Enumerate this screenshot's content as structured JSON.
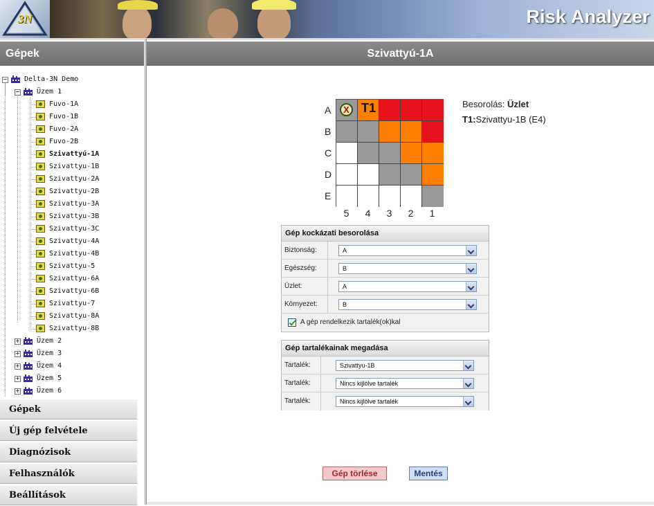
{
  "header": {
    "logo_text": "3N",
    "app_title": "Risk Analyzer"
  },
  "left_panel": {
    "title": "Gépek"
  },
  "tree": {
    "root": "Delta-3N Demo",
    "plant_open": "Üzem 1",
    "machines": [
      "Fuvo-1A",
      "Fuvo-1B",
      "Fuvo-2A",
      "Fuvo-2B",
      "Szivattyú-1A",
      "Szivattyu-1B",
      "Szivattyu-2A",
      "Szivattyu-2B",
      "Szivattyu-3A",
      "Szivattyu-3B",
      "Szivattyu-3C",
      "Szivattyu-4A",
      "Szivattyu-4B",
      "Szivattyu-5",
      "Szivattyu-6A",
      "Szivattyu-6B",
      "Szivattyu-7",
      "Szivattyu-8A",
      "Szivattyu-8B"
    ],
    "selected": "Szivattyú-1A",
    "other_plants": [
      "Üzem 2",
      "Üzem 3",
      "Üzem 4",
      "Üzem 5",
      "Üzem 6"
    ],
    "expand_symbol": "+",
    "collapse_symbol": "−"
  },
  "nav": {
    "items": [
      "Gépek",
      "Új gép felvétele",
      "Diagnózisok",
      "Felhasználók",
      "Beállítások"
    ]
  },
  "main": {
    "title": "Szivattyú-1A"
  },
  "matrix": {
    "rows": [
      "A",
      "B",
      "C",
      "D",
      "E"
    ],
    "cols": [
      "5",
      "4",
      "3",
      "2",
      "1"
    ],
    "colors": {
      "red": "#e8141b",
      "orange": "#ff8000",
      "gray": "#999999",
      "white": "#ffffff"
    },
    "cells": [
      [
        "gray",
        "orange",
        "red",
        "red",
        "red"
      ],
      [
        "gray",
        "gray",
        "orange",
        "orange",
        "red"
      ],
      [
        "white",
        "gray",
        "gray",
        "orange",
        "orange"
      ],
      [
        "white",
        "white",
        "gray",
        "gray",
        "orange"
      ],
      [
        "white",
        "white",
        "white",
        "white",
        "gray"
      ]
    ],
    "machine_marker": "X",
    "backup_marker": "T1"
  },
  "info": {
    "classification_label": "Besorolás:",
    "classification_value": "Üzlet",
    "backup_label": "T1:",
    "backup_value": "Szivattyu-1B (E4)"
  },
  "risk_panel": {
    "title": "Gép kockázati besorolása",
    "fields": [
      {
        "label": "Biztonság:",
        "value": "A"
      },
      {
        "label": "Egészség:",
        "value": "B"
      },
      {
        "label": "Üzlet:",
        "value": "A"
      },
      {
        "label": "Környezet:",
        "value": "B"
      }
    ],
    "checkbox_label": "A gép rendelkezik tartalék(ok)kal"
  },
  "backup_panel": {
    "title": "Gép tartalékainak megadása",
    "fields": [
      {
        "label": "Tartalék:",
        "value": "Szivattyu-1B"
      },
      {
        "label": "Tartalék:",
        "value": "Nincs kijlölve tartalék"
      },
      {
        "label": "Tartalék:",
        "value": "Nincs kijlölve tartalék"
      }
    ]
  },
  "buttons": {
    "delete": "Gép törlése",
    "save": "Mentés"
  }
}
